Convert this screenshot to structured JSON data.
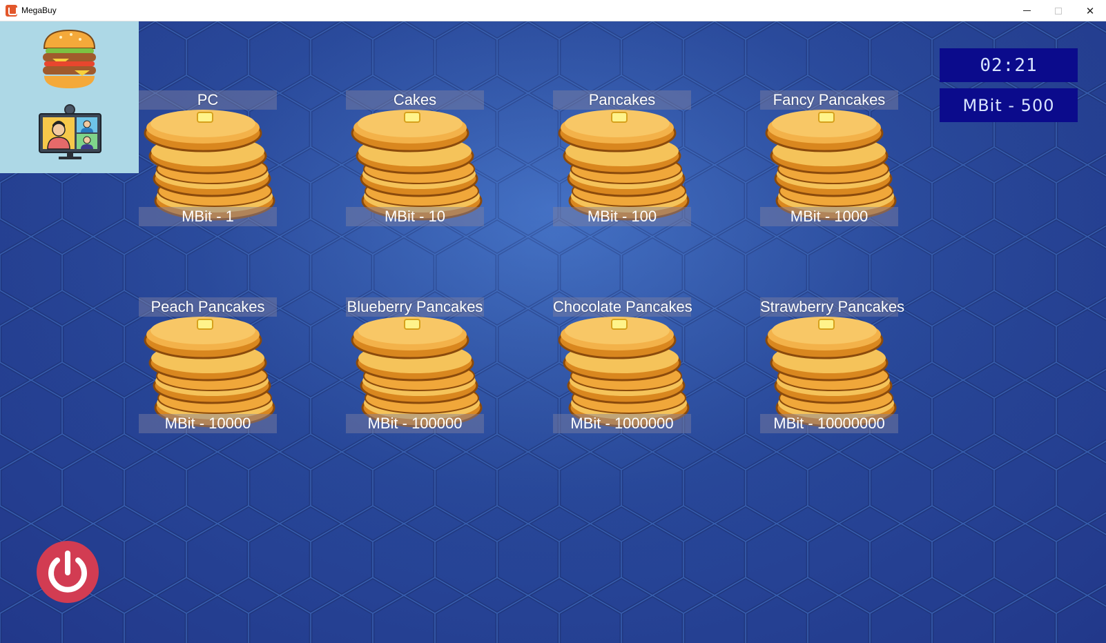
{
  "window": {
    "title": "MegaBuy"
  },
  "titlebar": {
    "minimize_icon": "minimize-icon",
    "maximize_icon": "maximize-icon",
    "close_icon": "close-icon"
  },
  "sidebar": {
    "burger_icon": "burger-icon",
    "video_call_icon": "video-call-icon"
  },
  "status": {
    "timer": "02:21",
    "balance": "MBit - 500"
  },
  "items": [
    {
      "name": "PC",
      "price": "MBit - 1"
    },
    {
      "name": "Cakes",
      "price": "MBit - 10"
    },
    {
      "name": "Pancakes",
      "price": "MBit - 100"
    },
    {
      "name": "Fancy Pancakes",
      "price": "MBit - 1000"
    },
    {
      "name": "Peach Pancakes",
      "price": "MBit - 10000"
    },
    {
      "name": "Blueberry Pancakes",
      "price": "MBit - 100000"
    },
    {
      "name": "Chocolate Pancakes",
      "price": "MBit - 1000000"
    },
    {
      "name": "Strawberry Pancakes",
      "price": "MBit - 10000000"
    }
  ],
  "footer": {
    "power_icon": "power-icon"
  },
  "colors": {
    "side_panel": "#add8e6",
    "status_box": "#0b0b8c",
    "power_button": "#d23c52",
    "background": "#28489a"
  }
}
